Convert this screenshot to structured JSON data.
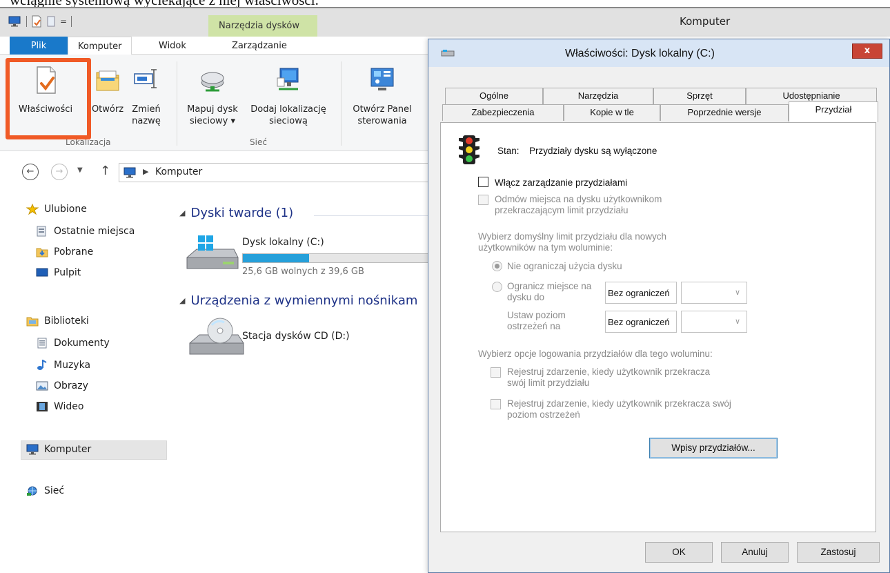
{
  "caption": "wciągnie systemową wyciekające z niej właściwości.",
  "explorer": {
    "window_title": "Komputer",
    "tools_tab": "Narzędzia dysków",
    "tabs": {
      "file": "Plik",
      "computer": "Komputer",
      "view": "Widok",
      "manage": "Zarządzanie"
    },
    "ribbon": {
      "properties": "Właściwości",
      "open": "Otwórz",
      "rename_1": "Zmień",
      "rename_2": "nazwę",
      "map_drive_1": "Mapuj dysk",
      "map_drive_2": "sieciowy ▾",
      "add_location_1": "Dodaj lokalizację",
      "add_location_2": "sieciową",
      "control_panel_1": "Otwórz Panel",
      "control_panel_2": "sterowania",
      "group_location": "Lokalizacja",
      "group_network": "Sieć"
    },
    "address": {
      "path": "Komputer"
    },
    "nav": {
      "favorites": "Ulubione",
      "recent": "Ostatnie miejsca",
      "downloads": "Pobrane",
      "desktop": "Pulpit",
      "libraries": "Biblioteki",
      "documents": "Dokumenty",
      "music": "Muzyka",
      "pictures": "Obrazy",
      "video": "Wideo",
      "computer": "Komputer",
      "network": "Sieć"
    },
    "content": {
      "hard_drives_group": "Dyski twarde (1)",
      "drive_c_name": "Dysk lokalny (C:)",
      "drive_c_free": "25,6 GB wolnych z 39,6 GB",
      "drive_c_used_fraction": 0.354,
      "removable_group": "Urządzenia z wymiennymi nośnikam",
      "drive_d_name": "Stacja dysków CD (D:)"
    }
  },
  "dialog": {
    "title": "Właściwości: Dysk lokalny (C:)",
    "close": "x",
    "tabs_row1": [
      "Ogólne",
      "Narzędzia",
      "Sprzęt",
      "Udostępnianie"
    ],
    "tabs_row2": [
      "Zabezpieczenia",
      "Kopie w tle",
      "Poprzednie wersje",
      "Przydział"
    ],
    "status_label": "Stan:",
    "status_value": "Przydziały dysku są wyłączone",
    "enable_quota": "Włącz zarządzanie przydziałami",
    "deny_space_1": "Odmów miejsca na dysku użytkownikom",
    "deny_space_2": "przekraczającym limit przydziału",
    "default_limit_1": "Wybierz domyślny limit przydziału dla nowych",
    "default_limit_2": "użytkowników na tym woluminie:",
    "no_limit": "Nie ograniczaj użycia dysku",
    "limit_space_1": "Ogranicz miejsce na",
    "limit_space_2": "dysku do",
    "limit_value": "Bez ograniczeń",
    "warning_1": "Ustaw poziom",
    "warning_2": "ostrzeżeń na",
    "warning_value": "Bez ograniczeń",
    "logging_options": "Wybierz opcje logowania przydziałów dla tego woluminu:",
    "log_limit_1": "Rejestruj zdarzenie, kiedy użytkownik przekracza",
    "log_limit_2": "swój limit przydziału",
    "log_warning_1": "Rejestruj zdarzenie, kiedy użytkownik przekracza swój",
    "log_warning_2": "poziom ostrzeżeń",
    "quota_entries": "Wpisy przydziałów...",
    "ok": "OK",
    "cancel": "Anuluj",
    "apply": "Zastosuj"
  },
  "colors": {
    "accent": "#1979ca",
    "highlight": "#f05a26",
    "tools_tab": "#cfe3a6",
    "progress": "#26a0da"
  }
}
